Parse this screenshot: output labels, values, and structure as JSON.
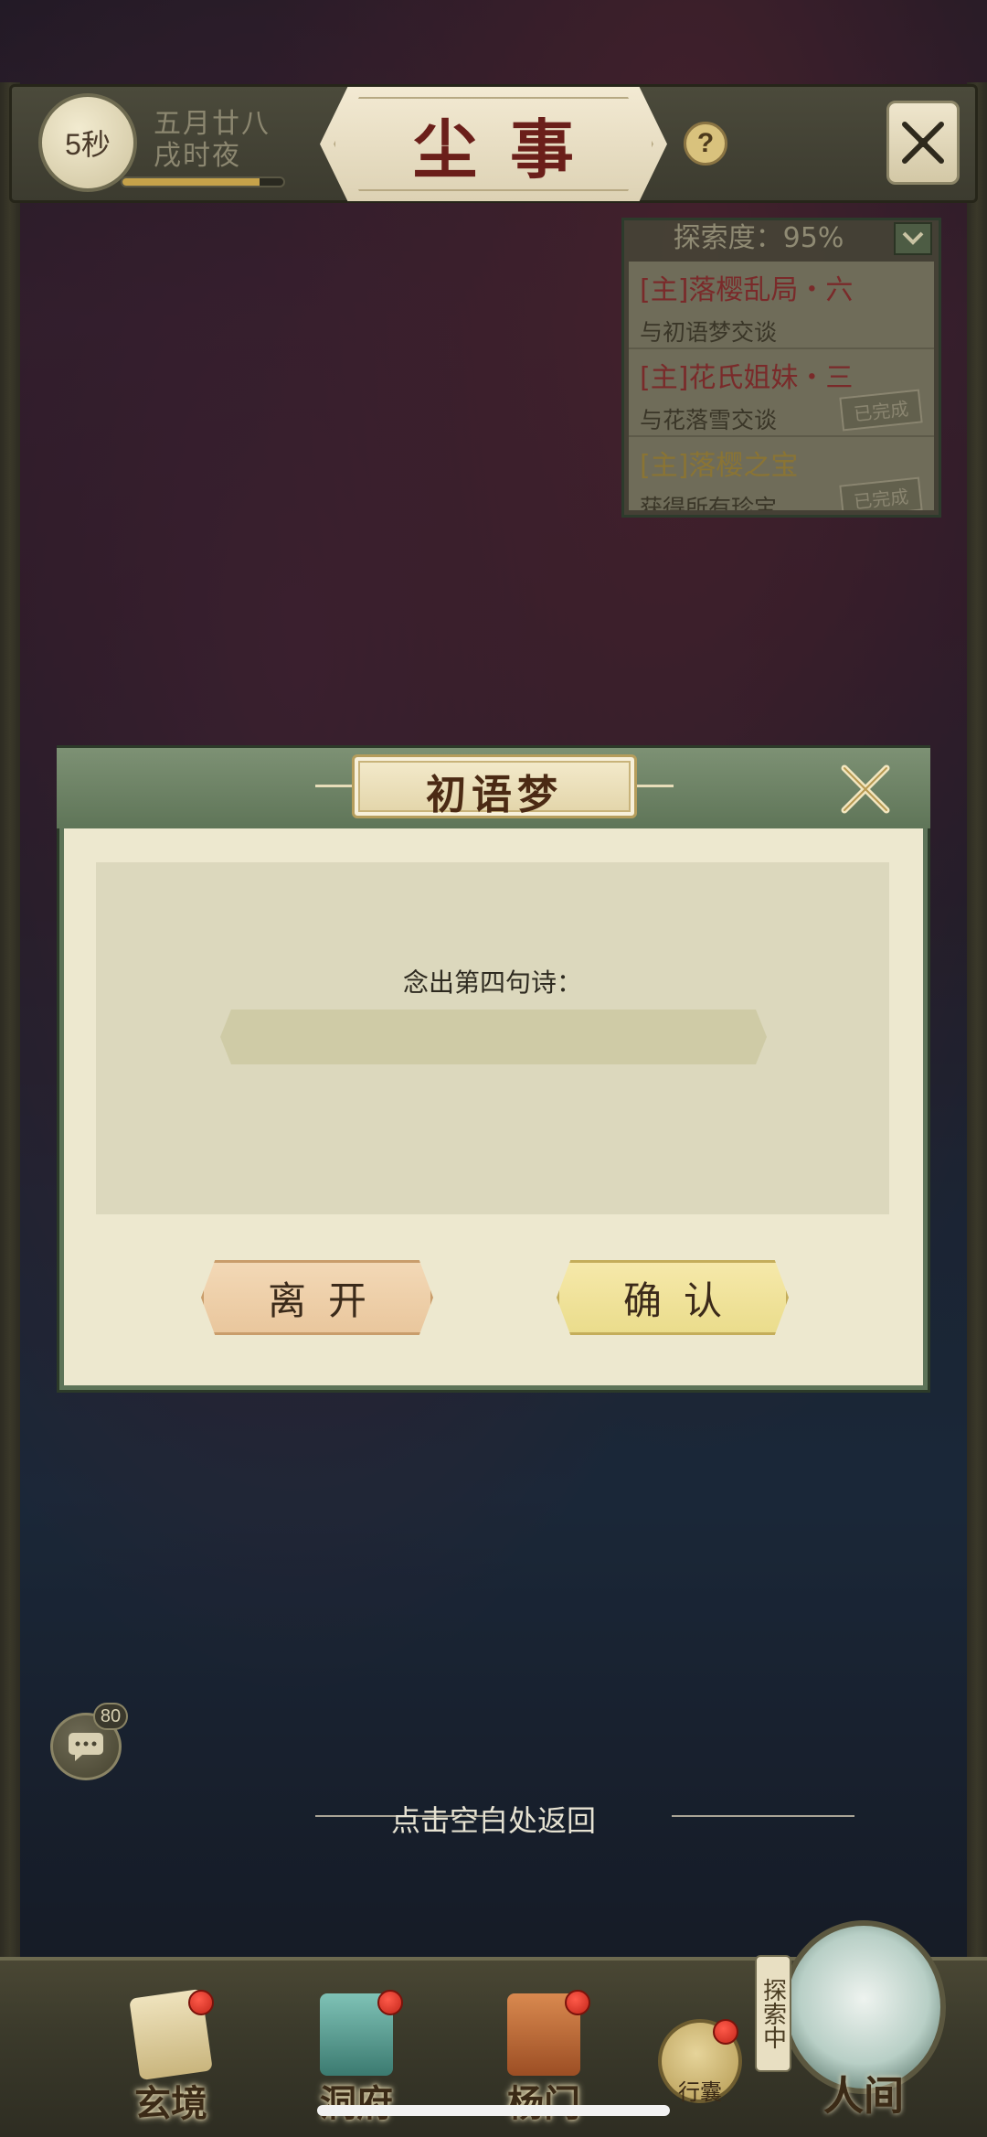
{
  "header": {
    "timer": "5秒",
    "date_line1": "五月廿八",
    "date_line2": "戌时夜",
    "time_progress": 0.85,
    "title": "尘事",
    "help_icon": "question-icon",
    "close_icon": "crossed-swords-icon"
  },
  "quest_panel": {
    "explore_label": "探索度：95%",
    "toggle_icon": "chevron-down-icon",
    "quests": [
      {
        "name": "[主]落樱乱局・六",
        "desc": "与初语梦交谈",
        "done": ""
      },
      {
        "name": "[主]花氏姐妹・三",
        "desc": "与花落雪交谈",
        "done": "已完成"
      },
      {
        "name": "[主]落樱之宝",
        "desc": "获得所有珍宝",
        "done": "已完成"
      }
    ]
  },
  "dialog": {
    "title": "初语梦",
    "prompt": "念出第四句诗：",
    "input_value": "",
    "leave_label": "离开",
    "confirm_label": "确认",
    "close_icon": "crossed-swords-icon"
  },
  "chat": {
    "count": "80",
    "icon": "chat-bubble-icon"
  },
  "return_hint": "点击空白处返回",
  "bottom_nav": {
    "items": [
      {
        "label": "玄境",
        "icon": "scroll-icon"
      },
      {
        "label": "洞府",
        "icon": "pavilion-icon"
      },
      {
        "label": "杨门",
        "icon": "banner-icon"
      }
    ],
    "bag_label": "行囊",
    "exploring_tag": "探索中",
    "renjian_label": "人间"
  },
  "colors": {
    "quest_main": "#7a2a2a",
    "quest_done": "#8a7434",
    "dialog_bg": "#ede8cf",
    "dialog_header": "#5f7558"
  }
}
